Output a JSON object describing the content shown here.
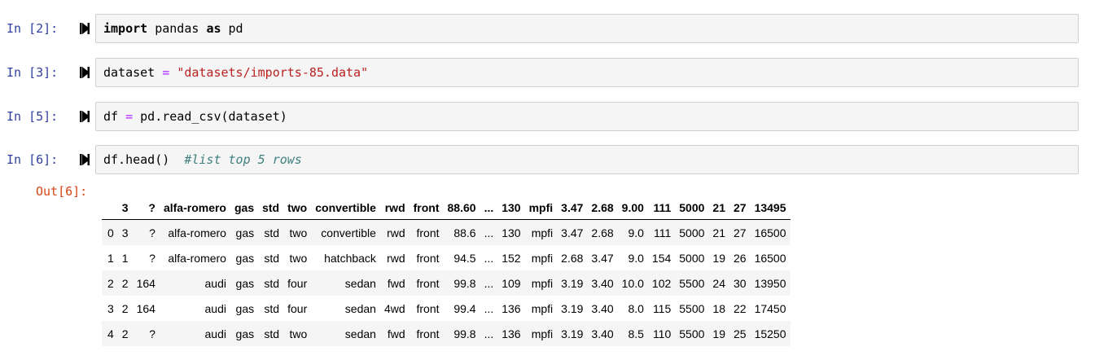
{
  "cells": [
    {
      "prompt": "In [2]:",
      "code": [
        {
          "t": "import",
          "c": "kw2"
        },
        {
          "t": " pandas ",
          "c": ""
        },
        {
          "t": "as",
          "c": "kw2"
        },
        {
          "t": " pd",
          "c": ""
        }
      ]
    },
    {
      "prompt": "In [3]:",
      "code": [
        {
          "t": "dataset ",
          "c": ""
        },
        {
          "t": "=",
          "c": "op"
        },
        {
          "t": " ",
          "c": ""
        },
        {
          "t": "\"datasets/imports-85.data\"",
          "c": "str"
        }
      ]
    },
    {
      "prompt": "In [5]:",
      "code": [
        {
          "t": "df ",
          "c": ""
        },
        {
          "t": "=",
          "c": "op"
        },
        {
          "t": " pd.read_csv(dataset)",
          "c": ""
        }
      ]
    },
    {
      "prompt": "In [6]:",
      "code": [
        {
          "t": "df.head()  ",
          "c": ""
        },
        {
          "t": "#list top 5 rows",
          "c": "cmt"
        }
      ]
    }
  ],
  "output": {
    "prompt": "Out[6]:",
    "columns": [
      "",
      "3",
      "?",
      "alfa-romero",
      "gas",
      "std",
      "two",
      "convertible",
      "rwd",
      "front",
      "88.60",
      "...",
      "130",
      "mpfi",
      "3.47",
      "2.68",
      "9.00",
      "111",
      "5000",
      "21",
      "27",
      "13495"
    ],
    "rows": [
      [
        "0",
        "3",
        "?",
        "alfa-romero",
        "gas",
        "std",
        "two",
        "convertible",
        "rwd",
        "front",
        "88.6",
        "...",
        "130",
        "mpfi",
        "3.47",
        "2.68",
        "9.0",
        "111",
        "5000",
        "21",
        "27",
        "16500"
      ],
      [
        "1",
        "1",
        "?",
        "alfa-romero",
        "gas",
        "std",
        "two",
        "hatchback",
        "rwd",
        "front",
        "94.5",
        "...",
        "152",
        "mpfi",
        "2.68",
        "3.47",
        "9.0",
        "154",
        "5000",
        "19",
        "26",
        "16500"
      ],
      [
        "2",
        "2",
        "164",
        "audi",
        "gas",
        "std",
        "four",
        "sedan",
        "fwd",
        "front",
        "99.8",
        "...",
        "109",
        "mpfi",
        "3.19",
        "3.40",
        "10.0",
        "102",
        "5500",
        "24",
        "30",
        "13950"
      ],
      [
        "3",
        "2",
        "164",
        "audi",
        "gas",
        "std",
        "four",
        "sedan",
        "4wd",
        "front",
        "99.4",
        "...",
        "136",
        "mpfi",
        "3.19",
        "3.40",
        "8.0",
        "115",
        "5500",
        "18",
        "22",
        "17450"
      ],
      [
        "4",
        "2",
        "?",
        "audi",
        "gas",
        "std",
        "two",
        "sedan",
        "fwd",
        "front",
        "99.8",
        "...",
        "136",
        "mpfi",
        "3.19",
        "3.40",
        "8.5",
        "110",
        "5500",
        "19",
        "25",
        "15250"
      ]
    ]
  },
  "icons": {
    "run": "run-cell-icon"
  }
}
